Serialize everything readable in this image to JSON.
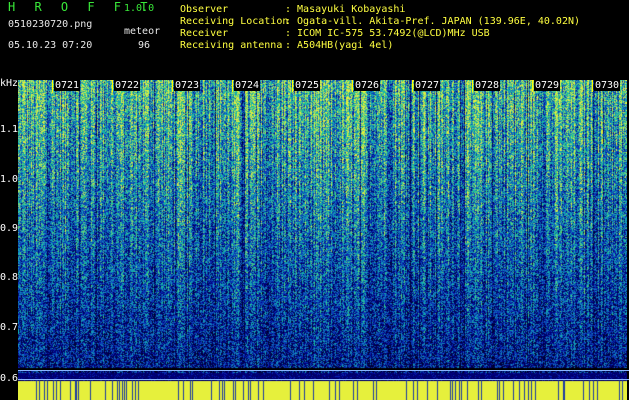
{
  "header": {
    "app_title": "H R O F F T",
    "version": "1.0.0",
    "filename": "0510230720.png",
    "mode_label": "meteor",
    "datetime": "05.10.23 07:20",
    "count": "96"
  },
  "info": {
    "observer_label": "Observer",
    "observer_value": ": Masayuki Kobayashi",
    "location_label": "Receiving Location",
    "location_value": ": Ogata-vill. Akita-Pref. JAPAN (139.96E, 40.02N)",
    "receiver_label": "Receiver",
    "receiver_value": ": ICOM IC-575 53.7492(@LCD)MHz USB",
    "antenna_label": "Receiving antenna",
    "antenna_value": ": A504HB(yagi 4el)"
  },
  "axis": {
    "unit": "kHz",
    "y_labels": [
      "1.1",
      "1.0",
      "0.9",
      "0.8",
      "0.7",
      "0.6"
    ],
    "time_labels": [
      "0721",
      "0722",
      "0723",
      "0724",
      "0725",
      "0726",
      "0727",
      "0728",
      "0729",
      "0730"
    ]
  },
  "colors": {
    "background": "#000000",
    "title_green": "#39e839",
    "info_yellow": "#ffff40",
    "spectrum_low": "#1020a0",
    "spectrum_high": "#ffff40"
  }
}
